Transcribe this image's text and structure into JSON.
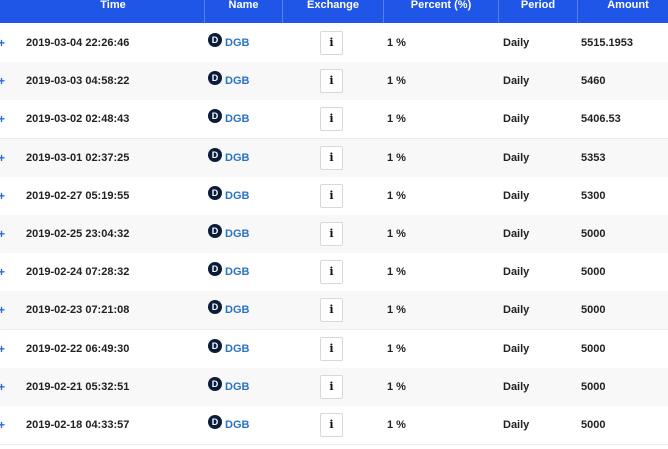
{
  "header": {
    "time": "Time",
    "name": "Name",
    "exchange": "Exchange",
    "percent": "Percent (%)",
    "period": "Period",
    "amount": "Amount"
  },
  "expand_symbol": "+",
  "info_symbol": "i",
  "coin_icon_glyph": "D",
  "rows": [
    {
      "time": "2019-03-04 22:26:46",
      "name": "DGB",
      "percent": "1 %",
      "period": "Daily",
      "amount": "5515.1953"
    },
    {
      "time": "2019-03-03 04:58:22",
      "name": "DGB",
      "percent": "1 %",
      "period": "Daily",
      "amount": "5460"
    },
    {
      "time": "2019-03-02 02:48:43",
      "name": "DGB",
      "percent": "1 %",
      "period": "Daily",
      "amount": "5406.53"
    },
    {
      "time": "2019-03-01 02:37:25",
      "name": "DGB",
      "percent": "1 %",
      "period": "Daily",
      "amount": "5353"
    },
    {
      "time": "2019-02-27 05:19:55",
      "name": "DGB",
      "percent": "1 %",
      "period": "Daily",
      "amount": "5300"
    },
    {
      "time": "2019-02-25 23:04:32",
      "name": "DGB",
      "percent": "1 %",
      "period": "Daily",
      "amount": "5000"
    },
    {
      "time": "2019-02-24 07:28:32",
      "name": "DGB",
      "percent": "1 %",
      "period": "Daily",
      "amount": "5000"
    },
    {
      "time": "2019-02-23 07:21:08",
      "name": "DGB",
      "percent": "1 %",
      "period": "Daily",
      "amount": "5000"
    },
    {
      "time": "2019-02-22 06:49:30",
      "name": "DGB",
      "percent": "1 %",
      "period": "Daily",
      "amount": "5000"
    },
    {
      "time": "2019-02-21 05:32:51",
      "name": "DGB",
      "percent": "1 %",
      "period": "Daily",
      "amount": "5000"
    },
    {
      "time": "2019-02-18 04:33:57",
      "name": "DGB",
      "percent": "1 %",
      "period": "Daily",
      "amount": "5000"
    }
  ],
  "colors": {
    "header_bg": "#1f56e8",
    "link": "#2a74c7",
    "coin_icon": "#0b1c3b"
  }
}
